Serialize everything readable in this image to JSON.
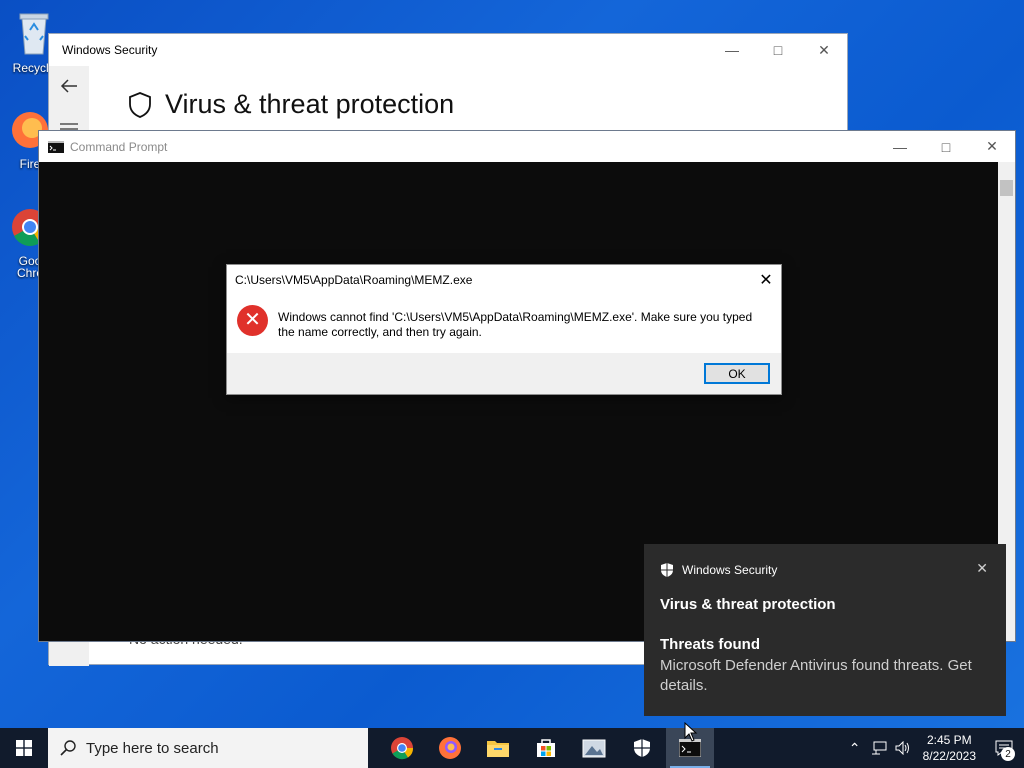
{
  "desktop": {
    "icons": [
      {
        "label": "Recycle"
      },
      {
        "label": "Fire"
      },
      {
        "label": "Goo"
      },
      {
        "label": "Chro"
      }
    ]
  },
  "windows_security": {
    "title": "Windows Security",
    "heading": "Virus & threat protection",
    "footer_text": "No action needed."
  },
  "command_prompt": {
    "title": "Command Prompt"
  },
  "error_dialog": {
    "title": "C:\\Users\\VM5\\AppData\\Roaming\\MEMZ.exe",
    "message": "Windows cannot find 'C:\\Users\\VM5\\AppData\\Roaming\\MEMZ.exe'. Make sure you typed the name correctly, and then try again.",
    "ok_label": "OK"
  },
  "toast": {
    "app": "Windows Security",
    "title": "Virus & threat protection",
    "subtitle": "Threats found",
    "body": "Microsoft Defender Antivirus found threats. Get details."
  },
  "taskbar": {
    "search_placeholder": "Type here to search",
    "apps": [
      "chrome-icon",
      "firefox-icon",
      "file-explorer-icon",
      "store-icon",
      "photos-icon",
      "windows-security-icon",
      "command-prompt-icon"
    ],
    "time": "2:45 PM",
    "date": "8/22/2023",
    "notification_count": "2"
  },
  "colors": {
    "desktop": "#0a4fc4",
    "taskbar": "#111b2c",
    "accent": "#0078d7",
    "error": "#e0312b",
    "toast_bg": "#2b2b2b"
  }
}
